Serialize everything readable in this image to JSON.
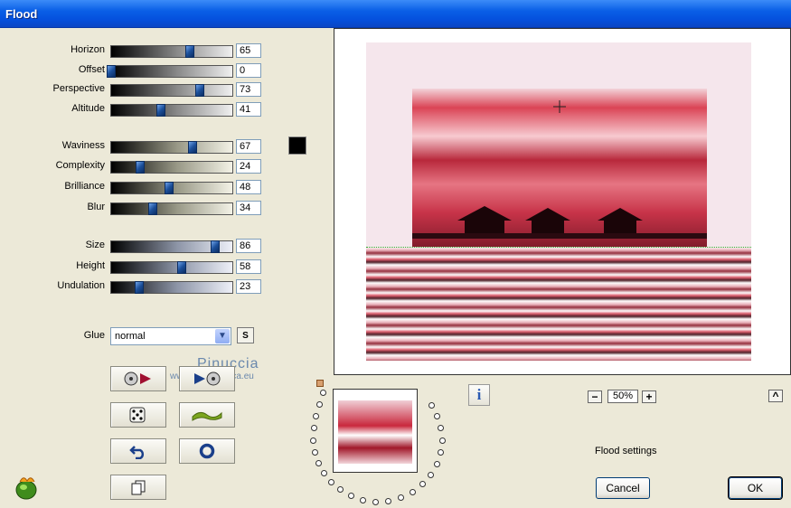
{
  "window": {
    "title": "Flood"
  },
  "groups": [
    {
      "style": "dark",
      "sliders": [
        {
          "key": "horizon",
          "label": "Horizon",
          "value": "65",
          "fraction": 0.65
        },
        {
          "key": "offset",
          "label": "Offset",
          "value": "0",
          "fraction": 0.0
        },
        {
          "key": "perspective",
          "label": "Perspective",
          "value": "73",
          "fraction": 0.73
        },
        {
          "key": "altitude",
          "label": "Altitude",
          "value": "41",
          "fraction": 0.41
        }
      ]
    },
    {
      "style": "olive",
      "sliders": [
        {
          "key": "waviness",
          "label": "Waviness",
          "value": "67",
          "fraction": 0.67
        },
        {
          "key": "complexity",
          "label": "Complexity",
          "value": "24",
          "fraction": 0.24
        },
        {
          "key": "brilliance",
          "label": "Brilliance",
          "value": "48",
          "fraction": 0.48
        },
        {
          "key": "blur",
          "label": "Blur",
          "value": "34",
          "fraction": 0.34
        }
      ]
    },
    {
      "style": "blue",
      "sliders": [
        {
          "key": "size",
          "label": "Size",
          "value": "86",
          "fraction": 0.86
        },
        {
          "key": "height",
          "label": "Height",
          "value": "58",
          "fraction": 0.58
        },
        {
          "key": "undulation",
          "label": "Undulation",
          "value": "23",
          "fraction": 0.23
        }
      ]
    }
  ],
  "color_swatch": "#000000",
  "glue": {
    "label": "Glue",
    "value": "normal",
    "s_label": "S"
  },
  "watermark": {
    "name": "Pinuccia",
    "url": "www.artedigrafica.eu"
  },
  "zoom": {
    "value": "50%",
    "minus": "−",
    "plus": "+"
  },
  "info_label": "i",
  "collapse_label": "^",
  "settings_label": "Flood settings",
  "buttons": {
    "cancel": "Cancel",
    "ok": "OK"
  }
}
